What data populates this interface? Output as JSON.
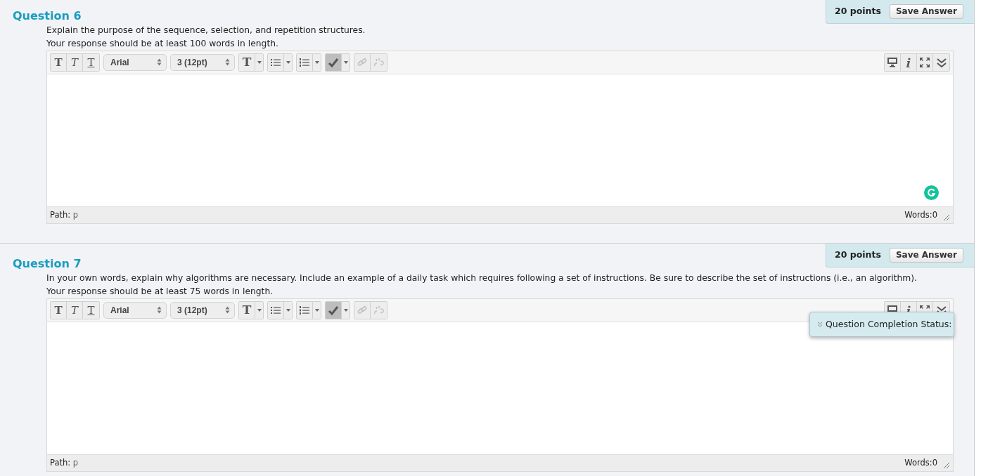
{
  "questions": [
    {
      "title": "Question 6",
      "points": "20 points",
      "save_button": "Save Answer",
      "prompt_lines": [
        "Explain the purpose of the sequence, selection, and repetition structures.",
        "Your response should be at least 100 words in length."
      ],
      "editor": {
        "format_buttons": [
          {
            "label": "T",
            "kind": "bold"
          },
          {
            "label": "T",
            "kind": "italic"
          },
          {
            "label": "T",
            "kind": "underline"
          }
        ],
        "font": "Arial",
        "size": "3 (12pt)",
        "color_button": "T",
        "spellcheck_active": true,
        "path_label": "Path:",
        "path": "p",
        "words": "Words:0",
        "grammar_badge": true
      }
    },
    {
      "title": "Question 7",
      "points": "20 points",
      "save_button": "Save Answer",
      "prompt_lines": [
        "In your own words, explain why algorithms are necessary. Include an example of a daily task which requires following a set of instructions. Be sure to describe the set of instructions (i.e., an algorithm).",
        "Your response should be at least 75 words in length."
      ],
      "editor": {
        "format_buttons": [
          {
            "label": "T",
            "kind": "bold"
          },
          {
            "label": "T",
            "kind": "italic"
          },
          {
            "label": "T",
            "kind": "underline"
          }
        ],
        "font": "Arial",
        "size": "3 (12pt)",
        "color_button": "T",
        "spellcheck_active": true,
        "path_label": "Path:",
        "path": "p",
        "words": "Words:0",
        "grammar_badge": false
      }
    }
  ],
  "completion_status": {
    "label": "Question Completion Status:"
  }
}
